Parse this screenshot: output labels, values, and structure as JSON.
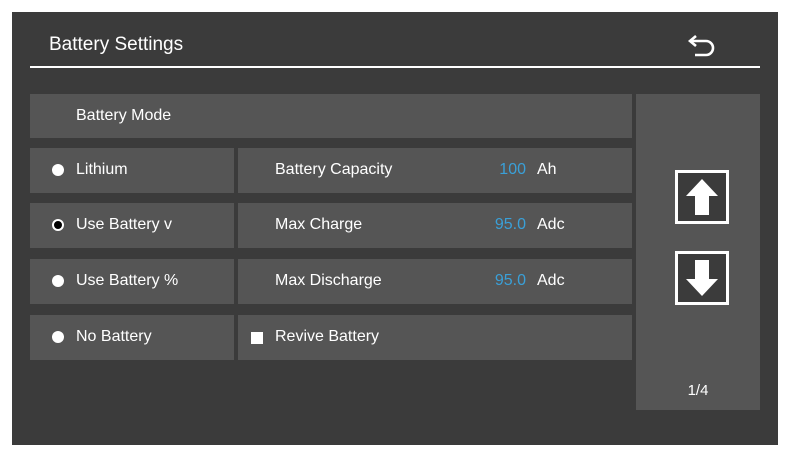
{
  "header": {
    "title": "Battery Settings",
    "back_icon": "back-arrow-icon"
  },
  "battery_mode": {
    "heading": "Battery Mode",
    "options": [
      {
        "label": "Lithium",
        "selected": false
      },
      {
        "label": "Use Battery v",
        "selected": true
      },
      {
        "label": "Use Battery %",
        "selected": false
      },
      {
        "label": "No Battery",
        "selected": false
      }
    ]
  },
  "fields": {
    "capacity": {
      "label": "Battery Capacity",
      "value": "100",
      "unit": "Ah"
    },
    "max_charge": {
      "label": "Max Charge",
      "value": "95.0",
      "unit": "Adc"
    },
    "max_discharge": {
      "label": "Max Discharge",
      "value": "95.0",
      "unit": "Adc"
    },
    "revive": {
      "label": "Revive Battery",
      "checked": false
    }
  },
  "pager": {
    "up_icon": "arrow-up-icon",
    "down_icon": "arrow-down-icon",
    "page": "1/4"
  },
  "colors": {
    "background": "#3b3b3b",
    "panel": "#555555",
    "value_accent": "#3aa0d8",
    "text": "#ffffff"
  }
}
